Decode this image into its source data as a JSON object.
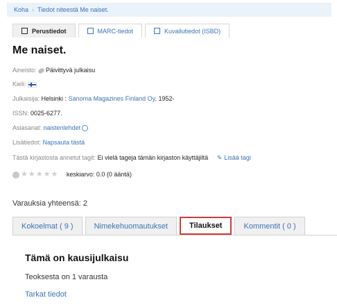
{
  "breadcrumb": {
    "home": "Koha",
    "separator": "›",
    "current": "Tiedot niteestä Me naiset."
  },
  "view_tabs": [
    {
      "label": "Perustiedot",
      "icon": "document-icon",
      "active": true
    },
    {
      "label": "MARC-tiedot",
      "icon": "list-icon",
      "active": false
    },
    {
      "label": "Kuvailutiedot (ISBD)",
      "icon": "card-icon",
      "active": false
    }
  ],
  "record": {
    "title": "Me naiset.",
    "material_label": "Aineisto:",
    "material_value": "Päivittyvä julkaisu",
    "language_label": "Kieli:",
    "publisher_label": "Julkaisija:",
    "publisher_place": "Helsinki",
    "publisher_sep": " : ",
    "publisher_name": "Sanoma Magazines Finland Oy,",
    "publisher_year": " 1952-",
    "issn_label": "ISSN:",
    "issn_value": "0025-6277.",
    "subjects_label": "Asiasanat:",
    "subject_value": "naistenlehdet",
    "notes_label": "Lisätiedot:",
    "notes_link": "Napsauta tästä",
    "tags_label": "Tästä kirjastosta annetut tagit:",
    "tags_value": "Ei vielä tageja tämän kirjaston käyttäjiltä",
    "add_tag": "Lisää tagi",
    "rating_text": "keskiarvo: 0.0 (0 ääntä)"
  },
  "holds_text": "Varauksia yhteensä: 2",
  "tabs": [
    {
      "label": "Kokoelmat ( 9 )",
      "active": false
    },
    {
      "label": "Nimekehuomautukset",
      "active": false
    },
    {
      "label": "Tilaukset",
      "active": true
    },
    {
      "label": "Kommentit ( 0 )",
      "active": false
    }
  ],
  "panel": {
    "title": "Tämä on kausijulkaisu",
    "text": "Teoksesta on 1 varausta",
    "link": "Tarkat tiedot"
  }
}
